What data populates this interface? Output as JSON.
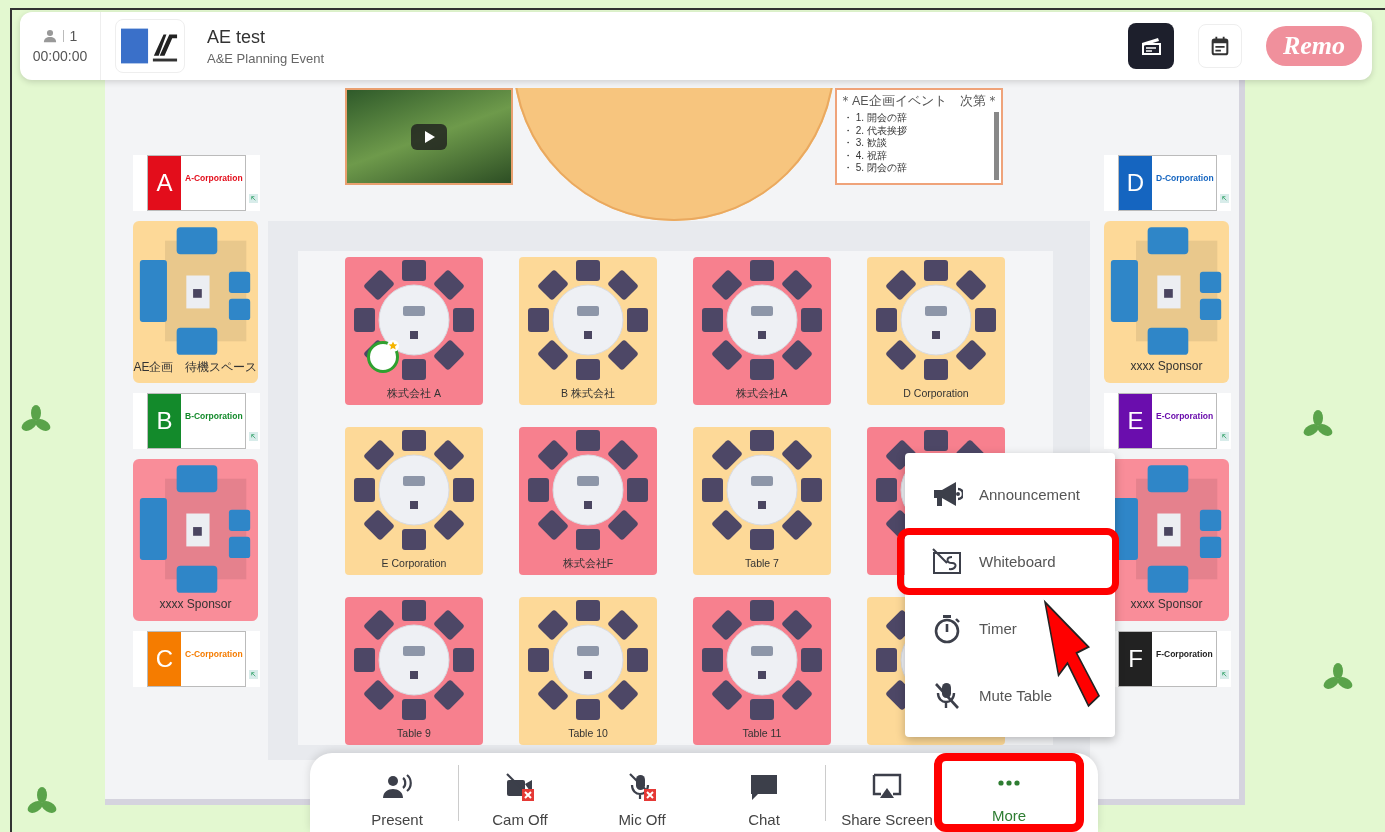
{
  "top_bar": {
    "participant_count": "1",
    "elapsed_time": "00:00:00",
    "event_title": "AE test",
    "event_subtitle": "A&E Planning Event",
    "brand": "Remo"
  },
  "stage": {
    "agenda": {
      "title": "＊AE企画イベント　次第＊",
      "items": [
        "・ 1. 開会の辞",
        "・ 2. 代表挨拶",
        "・ 3. 歓談",
        "・ 4. 祝辞",
        "・ 5. 閉会の辞"
      ]
    }
  },
  "left_column": [
    {
      "kind": "board",
      "letter": "A",
      "name": "A-Corporation",
      "color": "#e30d1b"
    },
    {
      "kind": "lounge",
      "label": "AE企画　待機スペース",
      "color": "#fdd998"
    },
    {
      "kind": "board",
      "letter": "B",
      "name": "B-Corporation",
      "color": "#138a2b"
    },
    {
      "kind": "lounge",
      "label": "xxxx Sponsor",
      "color": "#f98d99"
    },
    {
      "kind": "board",
      "letter": "C",
      "name": "C-Corporation",
      "color": "#f57c00"
    }
  ],
  "right_column": [
    {
      "kind": "board",
      "letter": "D",
      "name": "D-Corporation",
      "color": "#1565c0"
    },
    {
      "kind": "lounge",
      "label": "xxxx Sponsor",
      "color": "#fdd998"
    },
    {
      "kind": "board",
      "letter": "E",
      "name": "E-Corporation",
      "color": "#6a0dad"
    },
    {
      "kind": "lounge",
      "label": "xxxx Sponsor",
      "color": "#f98d99"
    },
    {
      "kind": "board",
      "letter": "F",
      "name": "F-Corporation",
      "color": "#222222"
    }
  ],
  "tables": [
    {
      "label": "株式会社 A",
      "color": "#f7808e",
      "has_guest": true
    },
    {
      "label": "B 株式会社",
      "color": "#fdd998",
      "has_guest": false
    },
    {
      "label": "株式会社A",
      "color": "#f7808e",
      "has_guest": false
    },
    {
      "label": "D Corporation",
      "color": "#fdd998",
      "has_guest": false
    },
    {
      "label": "E Corporation",
      "color": "#fdd998",
      "has_guest": false
    },
    {
      "label": "株式会社F",
      "color": "#f7808e",
      "has_guest": false
    },
    {
      "label": "Table 7",
      "color": "#fdd998",
      "has_guest": false
    },
    {
      "color": "#f7808e",
      "has_guest": false
    },
    {
      "label": "Table 9",
      "color": "#f7808e",
      "has_guest": false
    },
    {
      "label": "Table 10",
      "color": "#fdd998",
      "has_guest": false
    },
    {
      "label": "Table 11",
      "color": "#f7808e",
      "has_guest": false
    },
    {
      "color": "#fdd998",
      "has_guest": false
    }
  ],
  "menu": {
    "items": [
      {
        "kind": "announcement",
        "label": "Announcement",
        "highlighted": false
      },
      {
        "kind": "whiteboard",
        "label": "Whiteboard",
        "highlighted": true
      },
      {
        "kind": "timer",
        "label": "Timer",
        "highlighted": false
      },
      {
        "kind": "mute",
        "label": "Mute Table",
        "highlighted": false
      }
    ]
  },
  "toolbar": {
    "groups": [
      {
        "items": [
          {
            "kind": "present",
            "label": "Present",
            "selected": false,
            "highlighted": false
          }
        ]
      },
      {
        "items": [
          {
            "kind": "camera-off",
            "label": "Cam Off",
            "selected": false,
            "highlighted": false
          },
          {
            "kind": "mic-off",
            "label": "Mic Off",
            "selected": false,
            "highlighted": false
          },
          {
            "kind": "chat",
            "label": "Chat",
            "selected": false,
            "highlighted": false
          }
        ]
      },
      {
        "items": [
          {
            "kind": "share",
            "label": "Share Screen",
            "selected": false,
            "highlighted": false
          },
          {
            "kind": "more",
            "label": "More",
            "selected": true,
            "highlighted": true
          }
        ]
      }
    ]
  }
}
